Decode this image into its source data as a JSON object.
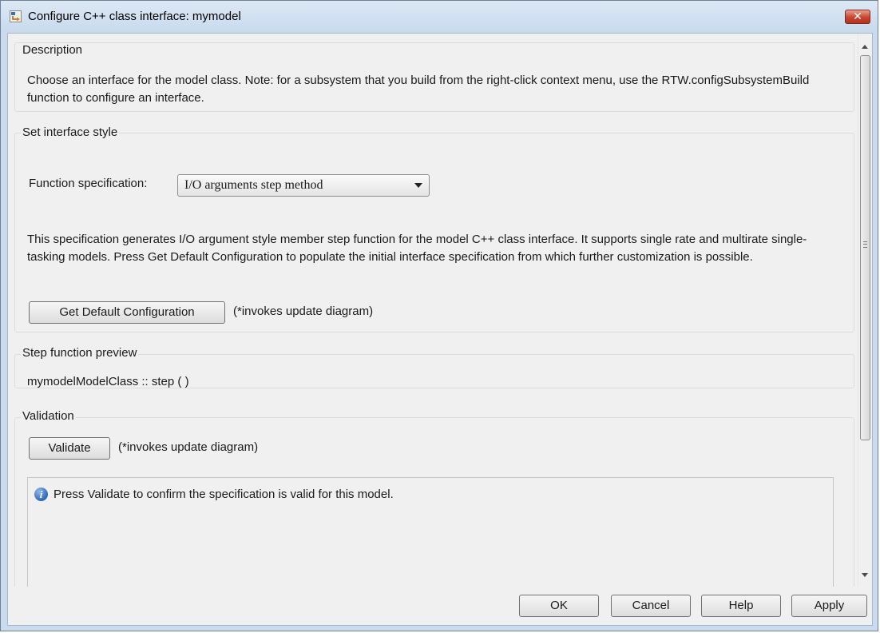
{
  "window": {
    "title": "Configure C++ class interface: mymodel",
    "close_label": "✕"
  },
  "description": {
    "legend": "Description",
    "text": "Choose an interface for the model class. Note: for a subsystem that you build from the right-click context menu, use the RTW.configSubsystemBuild function to configure an interface."
  },
  "interface_style": {
    "legend": "Set interface style",
    "function_spec_label": "Function specification:",
    "function_spec_value": "I/O arguments step method",
    "spec_text": "This specification generates I/O argument style member step function for the model C++ class interface. It supports single rate and multirate single-tasking models.  Press Get Default Configuration to populate the initial interface specification from which further customization is possible.",
    "get_default_label": "Get Default Configuration",
    "get_default_note": "(*invokes update diagram)"
  },
  "preview": {
    "legend": "Step function preview",
    "text": "mymodelModelClass :: step ( )"
  },
  "validation": {
    "legend": "Validation",
    "validate_label": "Validate",
    "validate_note": "(*invokes update diagram)",
    "message": "Press Validate to confirm the specification is valid for this model.",
    "info_glyph": "i"
  },
  "footer": {
    "ok_label": "OK",
    "cancel_label": "Cancel",
    "help_label": "Help",
    "apply_label": "Apply"
  },
  "icons": {
    "app": "simulink-model-icon",
    "close": "close-icon",
    "info": "info-icon",
    "dropdown": "chevron-down-icon"
  },
  "colors": {
    "titlebar": "#c8daee",
    "close_button": "#c8442f",
    "dialog_background": "#f0f0f0",
    "info_icon": "#2f67b8"
  }
}
